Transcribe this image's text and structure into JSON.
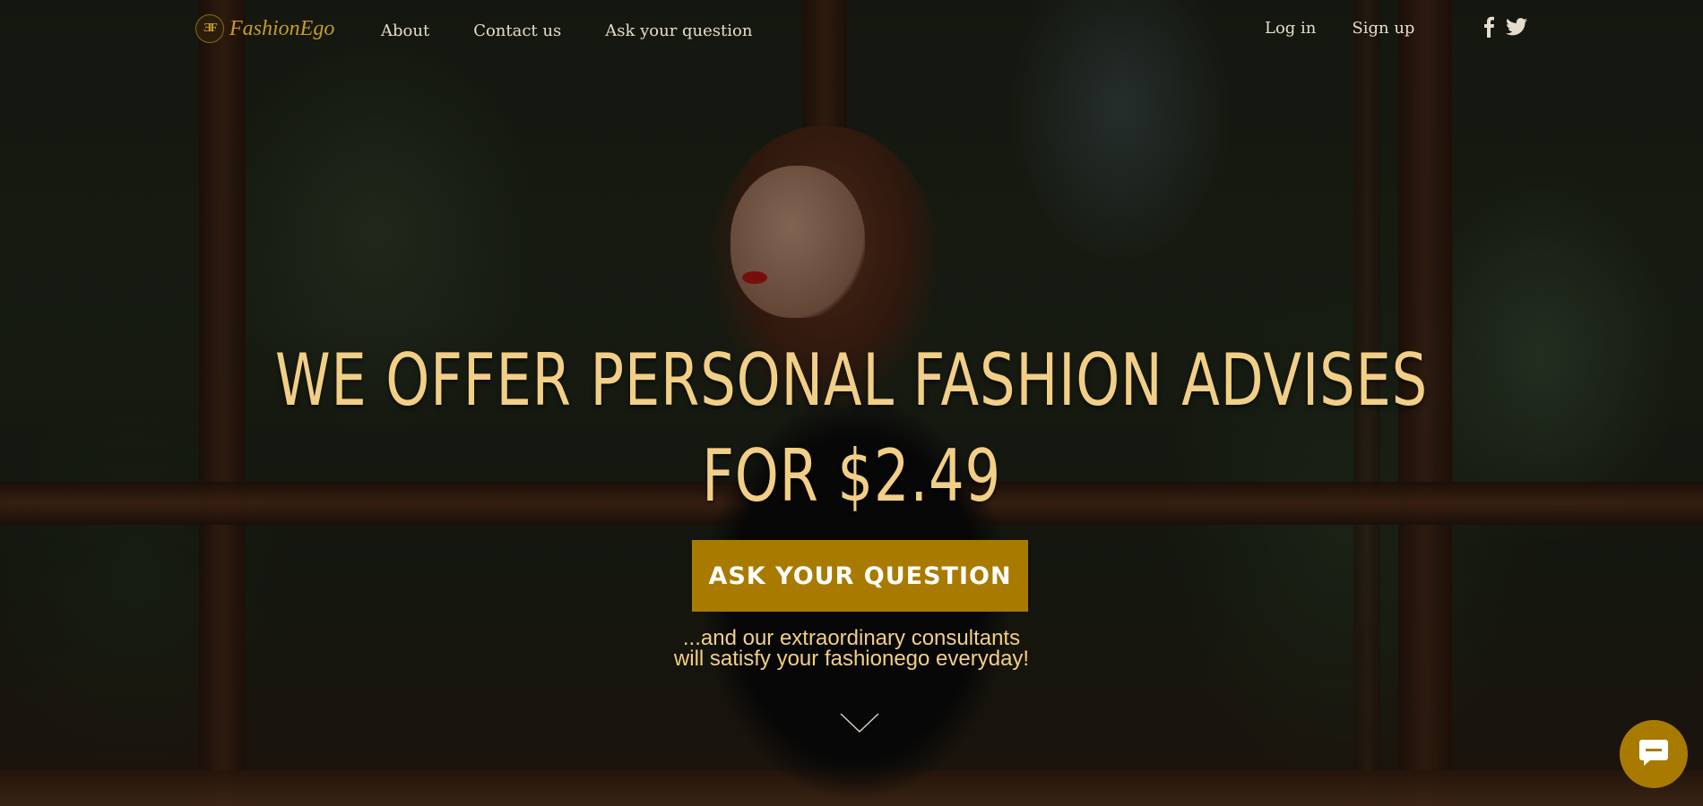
{
  "brand": {
    "name": "FashionEgo",
    "mark": "ƎF",
    "color": "#c99a2c"
  },
  "nav": {
    "links": [
      {
        "label": "About"
      },
      {
        "label": "Contact us"
      },
      {
        "label": "Ask your question"
      }
    ]
  },
  "auth": {
    "login": "Log in",
    "signup": "Sign up"
  },
  "social": {
    "icons": [
      "facebook-icon",
      "twitter-icon"
    ]
  },
  "hero": {
    "title_line1": "WE OFFER PERSONAL FASHION ADVISES",
    "title_line2": "FOR $2.49",
    "cta": "ASK YOUR QUESTION",
    "sub_line1": "...and our extraordinary consultants",
    "sub_line2": "will satisfy your fashionego everyday!"
  },
  "colors": {
    "accent": "#a87b00",
    "headline": "#f2cf86",
    "nav_text": "#e6dccb"
  },
  "icons": {
    "scroll": "chevron-down-icon",
    "chat": "chat-icon"
  }
}
